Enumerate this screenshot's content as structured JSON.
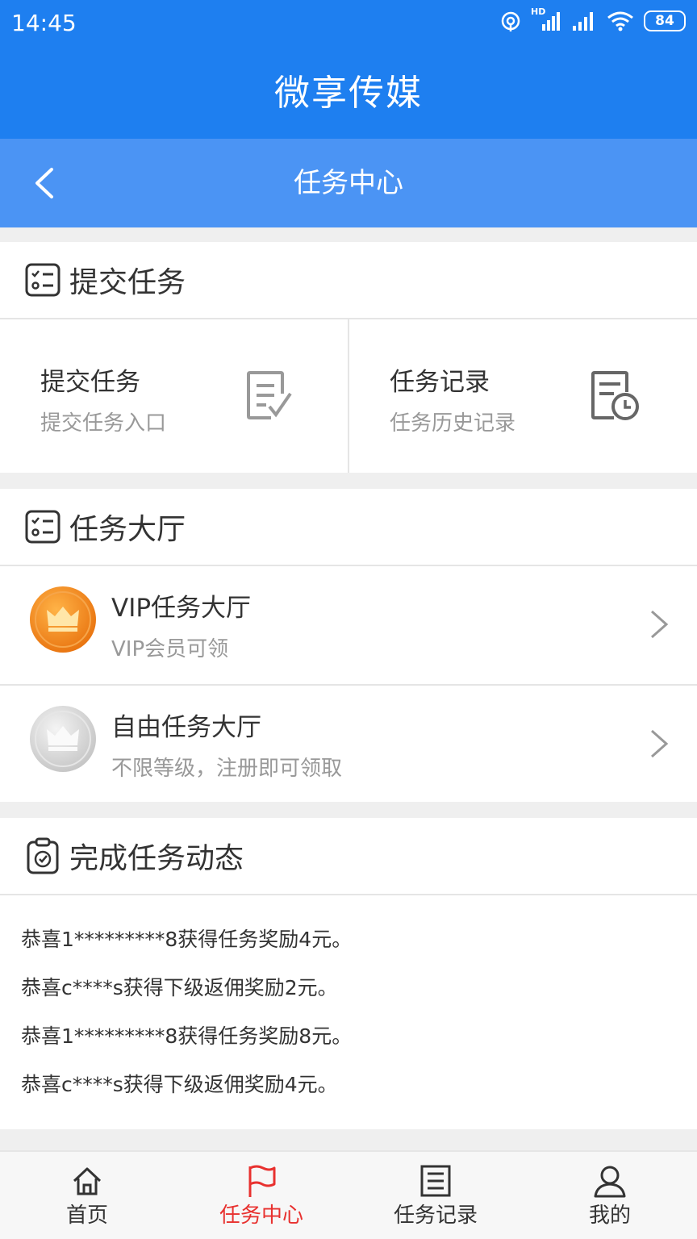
{
  "status": {
    "time": "14:45",
    "network_tag": "HD",
    "battery": "84"
  },
  "app": {
    "title": "微享传媒"
  },
  "nav": {
    "title": "任务中心"
  },
  "submit_section": {
    "title": "提交任务",
    "cells": [
      {
        "title": "提交任务",
        "subtitle": "提交任务入口",
        "icon": "edit-doc-icon"
      },
      {
        "title": "任务记录",
        "subtitle": "任务历史记录",
        "icon": "history-doc-icon"
      }
    ]
  },
  "hall_section": {
    "title": "任务大厅",
    "items": [
      {
        "title": "VIP任务大厅",
        "subtitle": "VIP会员可领",
        "medal_color": "#f08a1e",
        "icon": "gold-crown-icon"
      },
      {
        "title": "自由任务大厅",
        "subtitle": "不限等级，注册即可领取",
        "medal_color": "#d4d4d4",
        "icon": "silver-crown-icon"
      }
    ]
  },
  "news_section": {
    "title": "完成任务动态",
    "items": [
      "恭喜1*********8获得任务奖励4元。",
      "恭喜c****s获得下级返佣奖励2元。",
      "恭喜1*********8获得任务奖励8元。",
      "恭喜c****s获得下级返佣奖励4元。"
    ]
  },
  "tabbar": {
    "tabs": [
      {
        "label": "首页",
        "icon": "home-icon",
        "active": false
      },
      {
        "label": "任务中心",
        "icon": "flag-icon",
        "active": true
      },
      {
        "label": "任务记录",
        "icon": "list-icon",
        "active": false
      },
      {
        "label": "我的",
        "icon": "user-icon",
        "active": false
      }
    ]
  },
  "colors": {
    "primary": "#1e7ff0",
    "nav": "#4b94f4",
    "active": "#e8312f",
    "vip_medal": "#f08a1e",
    "free_medal": "#d4d4d4"
  }
}
